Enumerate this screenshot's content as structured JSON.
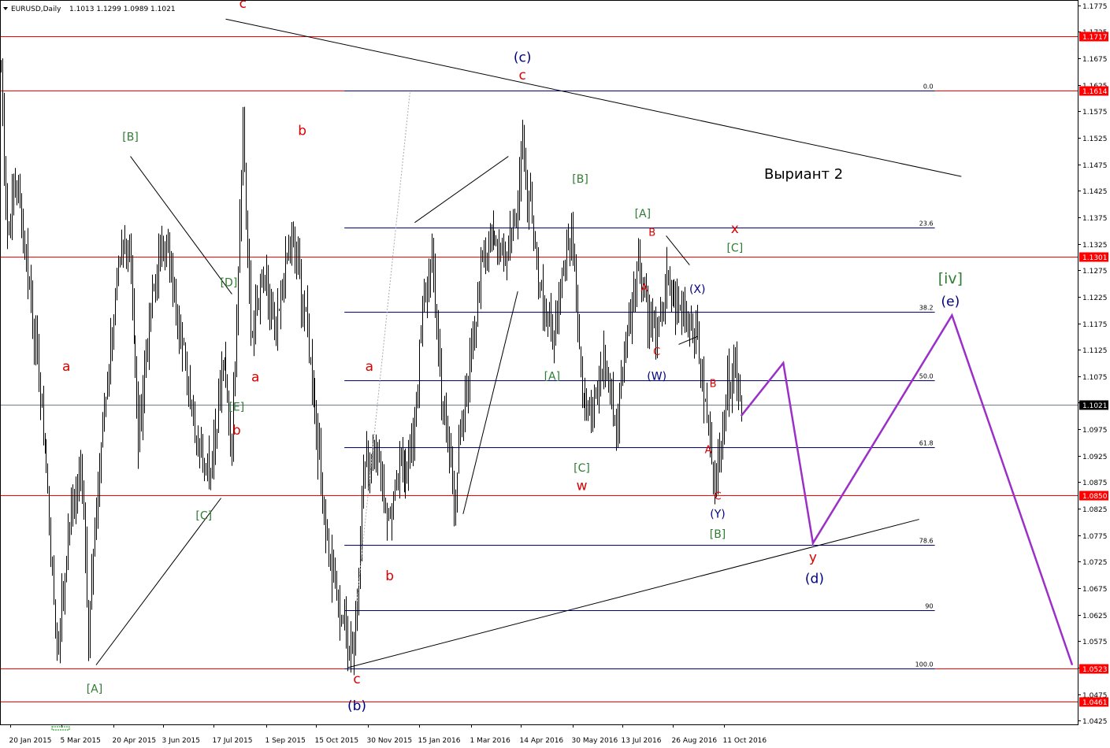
{
  "chart_data": {
    "type": "ohlc",
    "symbol_header": "EURUSD,Daily",
    "ohlc_header": "1.1013 1.1299 1.0989 1.1021",
    "variant_text": "Выриант 2",
    "ylim": [
      1.0418,
      1.1785
    ],
    "y_ticks": [
      "1.1775",
      "1.1725",
      "1.1675",
      "1.1625",
      "1.1575",
      "1.1525",
      "1.1475",
      "1.1425",
      "1.1375",
      "1.1325",
      "1.1275",
      "1.1225",
      "1.1175",
      "1.1125",
      "1.1075",
      "1.1025",
      "1.0975",
      "1.0925",
      "1.0875",
      "1.0825",
      "1.0775",
      "1.0725",
      "1.0675",
      "1.0625",
      "1.0575",
      "1.0525",
      "1.0475",
      "1.0425"
    ],
    "x_labels": [
      {
        "label": "20 Jan 2015",
        "bar": 6
      },
      {
        "label": "5 Mar 2015",
        "bar": 39
      },
      {
        "label": "20 Apr 2015",
        "bar": 72
      },
      {
        "label": "3 Jun 2015",
        "bar": 104
      },
      {
        "label": "17 Jul 2015",
        "bar": 136
      },
      {
        "label": "1 Sep 2015",
        "bar": 170
      },
      {
        "label": "15 Oct 2015",
        "bar": 202
      },
      {
        "label": "30 Nov 2015",
        "bar": 235
      },
      {
        "label": "15 Jan 2016",
        "bar": 268
      },
      {
        "label": "1 Mar 2016",
        "bar": 301
      },
      {
        "label": "14 Apr 2016",
        "bar": 333
      },
      {
        "label": "30 May 2016",
        "bar": 366
      },
      {
        "label": "13 Jul 2016",
        "bar": 398
      },
      {
        "label": "26 Aug 2016",
        "bar": 430
      },
      {
        "label": "11 Oct 2016",
        "bar": 463
      }
    ],
    "last_bar": 474,
    "total_bars": 690,
    "price_levels": [
      {
        "label": "1.1717",
        "value": 1.1717
      },
      {
        "label": "1.1614",
        "value": 1.1614
      },
      {
        "label": "1.1301",
        "value": 1.1301
      },
      {
        "label": "1.0850",
        "value": 1.085
      },
      {
        "label": "1.0523",
        "value": 1.0523
      },
      {
        "label": "1.0461",
        "value": 1.0461
      }
    ],
    "current_price": {
      "label": "1.1021",
      "value": 1.1021
    },
    "fib_levels": [
      {
        "label": "0.0",
        "value": 1.1614
      },
      {
        "label": "23.6",
        "value": 1.1356
      },
      {
        "label": "38.2",
        "value": 1.1196
      },
      {
        "label": "50.0",
        "value": 1.1068
      },
      {
        "label": "61.8",
        "value": 1.0941
      },
      {
        "label": "78.6",
        "value": 1.0757
      },
      {
        "label": "90",
        "value": 1.0633
      },
      {
        "label": "100.0",
        "value": 1.0523
      }
    ],
    "fib_bar_range": [
      220,
      598
    ],
    "anchors": [
      {
        "bar": 0,
        "close": 1.165
      },
      {
        "bar": 4,
        "close": 1.135
      },
      {
        "bar": 10,
        "close": 1.145
      },
      {
        "bar": 18,
        "close": 1.125
      },
      {
        "bar": 28,
        "close": 1.095
      },
      {
        "bar": 36,
        "close": 1.055
      },
      {
        "bar": 44,
        "close": 1.08
      },
      {
        "bar": 52,
        "close": 1.09
      },
      {
        "bar": 56,
        "close": 1.06
      },
      {
        "bar": 64,
        "close": 1.095
      },
      {
        "bar": 74,
        "close": 1.125
      },
      {
        "bar": 82,
        "close": 1.135
      },
      {
        "bar": 88,
        "close": 1.095
      },
      {
        "bar": 96,
        "close": 1.12
      },
      {
        "bar": 104,
        "close": 1.135
      },
      {
        "bar": 110,
        "close": 1.125
      },
      {
        "bar": 118,
        "close": 1.11
      },
      {
        "bar": 126,
        "close": 1.095
      },
      {
        "bar": 134,
        "close": 1.09
      },
      {
        "bar": 142,
        "close": 1.11
      },
      {
        "bar": 148,
        "close": 1.095
      },
      {
        "bar": 155,
        "close": 1.155
      },
      {
        "bar": 160,
        "close": 1.115
      },
      {
        "bar": 168,
        "close": 1.125
      },
      {
        "bar": 176,
        "close": 1.115
      },
      {
        "bar": 186,
        "close": 1.135
      },
      {
        "bar": 194,
        "close": 1.12
      },
      {
        "bar": 200,
        "close": 1.105
      },
      {
        "bar": 206,
        "close": 1.085
      },
      {
        "bar": 212,
        "close": 1.07
      },
      {
        "bar": 220,
        "close": 1.06
      },
      {
        "bar": 226,
        "close": 1.056
      },
      {
        "bar": 232,
        "close": 1.09
      },
      {
        "bar": 240,
        "close": 1.095
      },
      {
        "bar": 248,
        "close": 1.08
      },
      {
        "bar": 256,
        "close": 1.09
      },
      {
        "bar": 264,
        "close": 1.095
      },
      {
        "bar": 270,
        "close": 1.12
      },
      {
        "bar": 276,
        "close": 1.13
      },
      {
        "bar": 282,
        "close": 1.105
      },
      {
        "bar": 290,
        "close": 1.085
      },
      {
        "bar": 298,
        "close": 1.105
      },
      {
        "bar": 306,
        "close": 1.125
      },
      {
        "bar": 314,
        "close": 1.135
      },
      {
        "bar": 322,
        "close": 1.13
      },
      {
        "bar": 330,
        "close": 1.14
      },
      {
        "bar": 334,
        "close": 1.15
      },
      {
        "bar": 340,
        "close": 1.135
      },
      {
        "bar": 348,
        "close": 1.12
      },
      {
        "bar": 354,
        "close": 1.115
      },
      {
        "bar": 360,
        "close": 1.13
      },
      {
        "bar": 366,
        "close": 1.135
      },
      {
        "bar": 372,
        "close": 1.105
      },
      {
        "bar": 378,
        "close": 1.1
      },
      {
        "bar": 386,
        "close": 1.11
      },
      {
        "bar": 394,
        "close": 1.098
      },
      {
        "bar": 400,
        "close": 1.115
      },
      {
        "bar": 408,
        "close": 1.13
      },
      {
        "bar": 414,
        "close": 1.12
      },
      {
        "bar": 420,
        "close": 1.115
      },
      {
        "bar": 426,
        "close": 1.125
      },
      {
        "bar": 432,
        "close": 1.12
      },
      {
        "bar": 440,
        "close": 1.12
      },
      {
        "bar": 446,
        "close": 1.115
      },
      {
        "bar": 452,
        "close": 1.099
      },
      {
        "bar": 458,
        "close": 1.088
      },
      {
        "bar": 464,
        "close": 1.105
      },
      {
        "bar": 470,
        "close": 1.11
      },
      {
        "bar": 474,
        "close": 1.1021
      }
    ],
    "trend_lines": [
      {
        "points": [
          [
            144,
            1.1749
          ],
          [
            615,
            1.1452
          ]
        ],
        "color": "#000000"
      },
      {
        "points": [
          [
            222,
            1.0525
          ],
          [
            588,
            1.0805
          ]
        ],
        "color": "#000000"
      },
      {
        "points": [
          [
            61,
            1.053
          ],
          [
            141,
            1.0845
          ]
        ],
        "color": "#000000"
      },
      {
        "points": [
          [
            83,
            1.149
          ],
          [
            148,
            1.123
          ]
        ],
        "color": "#000000"
      },
      {
        "points": [
          [
            265,
            1.1365
          ],
          [
            325,
            1.149
          ]
        ],
        "color": "#000000"
      },
      {
        "points": [
          [
            296,
            1.0815
          ],
          [
            331,
            1.1235
          ]
        ],
        "color": "#000000"
      },
      {
        "points": [
          [
            426,
            1.134
          ],
          [
            441,
            1.1285
          ]
        ],
        "color": "#000000"
      },
      {
        "points": [
          [
            434,
            1.1135
          ],
          [
            446,
            1.115
          ]
        ],
        "color": "#000000"
      }
    ],
    "dotted_lines": [
      {
        "points": [
          [
            228,
            1.065
          ],
          [
            262,
            1.1612
          ]
        ],
        "color": "#aaaaaa"
      }
    ],
    "forecast_path": {
      "color": "#9b30c8",
      "points": [
        [
          474,
          1.1
        ],
        [
          501,
          1.11
        ],
        [
          520,
          1.076
        ],
        [
          609,
          1.119
        ],
        [
          686,
          1.053
        ]
      ]
    },
    "wave_labels": [
      {
        "text": "c",
        "bar": 155,
        "price": 1.177,
        "color": "#dd0000",
        "size": 17
      },
      {
        "text": "(c)",
        "bar": 334,
        "price": 1.1668,
        "color": "#000080",
        "size": 17
      },
      {
        "text": "c",
        "bar": 334,
        "price": 1.1635,
        "color": "#dd0000",
        "size": 17
      },
      {
        "text": "[B]",
        "bar": 83,
        "price": 1.152,
        "color": "#2e7d32",
        "size": 14
      },
      {
        "text": "b",
        "bar": 193,
        "price": 1.153,
        "color": "#dd0000",
        "size": 17
      },
      {
        "text": "[B]",
        "bar": 371,
        "price": 1.144,
        "color": "#2e7d32",
        "size": 14
      },
      {
        "text": "[A]",
        "bar": 411,
        "price": 1.1375,
        "color": "#2e7d32",
        "size": 14
      },
      {
        "text": "B",
        "bar": 417,
        "price": 1.134,
        "color": "#dd0000",
        "size": 13
      },
      {
        "text": "x",
        "bar": 470,
        "price": 1.1345,
        "color": "#dd0000",
        "size": 17
      },
      {
        "text": "[C]",
        "bar": 470,
        "price": 1.131,
        "color": "#2e7d32",
        "size": 14
      },
      {
        "text": "[iv]",
        "bar": 608,
        "price": 1.125,
        "color": "#2e7d32",
        "size": 19
      },
      {
        "text": "(e)",
        "bar": 608,
        "price": 1.1208,
        "color": "#000080",
        "size": 17
      },
      {
        "text": "[D]",
        "bar": 146,
        "price": 1.1245,
        "color": "#2e7d32",
        "size": 14
      },
      {
        "text": "A",
        "bar": 412,
        "price": 1.1235,
        "color": "#dd0000",
        "size": 13
      },
      {
        "text": "(X)",
        "bar": 446,
        "price": 1.1232,
        "color": "#000080",
        "size": 14
      },
      {
        "text": "C",
        "bar": 420,
        "price": 1.1115,
        "color": "#dd0000",
        "size": 13
      },
      {
        "text": "a",
        "bar": 42,
        "price": 1.1085,
        "color": "#dd0000",
        "size": 17
      },
      {
        "text": "a",
        "bar": 236,
        "price": 1.1085,
        "color": "#dd0000",
        "size": 17
      },
      {
        "text": "a",
        "bar": 163,
        "price": 1.1065,
        "color": "#dd0000",
        "size": 17
      },
      {
        "text": "[A]",
        "bar": 353,
        "price": 1.1068,
        "color": "#2e7d32",
        "size": 14
      },
      {
        "text": "(W)",
        "bar": 420,
        "price": 1.1068,
        "color": "#000080",
        "size": 14
      },
      {
        "text": "B",
        "bar": 456,
        "price": 1.1055,
        "color": "#dd0000",
        "size": 13
      },
      {
        "text": "[E]",
        "bar": 151,
        "price": 1.101,
        "color": "#2e7d32",
        "size": 14
      },
      {
        "text": "b",
        "bar": 151,
        "price": 1.0965,
        "color": "#dd0000",
        "size": 17
      },
      {
        "text": "A",
        "bar": 453,
        "price": 1.093,
        "color": "#dd0000",
        "size": 13
      },
      {
        "text": "[C]",
        "bar": 372,
        "price": 1.0895,
        "color": "#2e7d32",
        "size": 14
      },
      {
        "text": "w",
        "bar": 372,
        "price": 1.086,
        "color": "#dd0000",
        "size": 17
      },
      {
        "text": "C",
        "bar": 459,
        "price": 1.0842,
        "color": "#dd0000",
        "size": 13
      },
      {
        "text": "[C]",
        "bar": 130,
        "price": 1.0805,
        "color": "#2e7d32",
        "size": 14
      },
      {
        "text": "(Y)",
        "bar": 459,
        "price": 1.0808,
        "color": "#000080",
        "size": 14
      },
      {
        "text": "[B]",
        "bar": 459,
        "price": 1.077,
        "color": "#2e7d32",
        "size": 14
      },
      {
        "text": "y",
        "bar": 520,
        "price": 1.0725,
        "color": "#dd0000",
        "size": 17
      },
      {
        "text": "b",
        "bar": 249,
        "price": 1.069,
        "color": "#dd0000",
        "size": 17
      },
      {
        "text": "(d)",
        "bar": 521,
        "price": 1.0685,
        "color": "#000080",
        "size": 17
      },
      {
        "text": "[A]",
        "bar": 60,
        "price": 1.0478,
        "color": "#2e7d32",
        "size": 14
      },
      {
        "text": "c",
        "bar": 228,
        "price": 1.0495,
        "color": "#dd0000",
        "size": 17
      },
      {
        "text": "(b)",
        "bar": 228,
        "price": 1.0445,
        "color": "#000080",
        "size": 17
      }
    ],
    "colors": {
      "background": "#ffffff",
      "bars": "#000000",
      "price_level": "#ff0000",
      "fib": "#000080",
      "current_price_line": "#708090",
      "current_price_badge": "#000000",
      "forecast": "#9b30c8"
    }
  }
}
